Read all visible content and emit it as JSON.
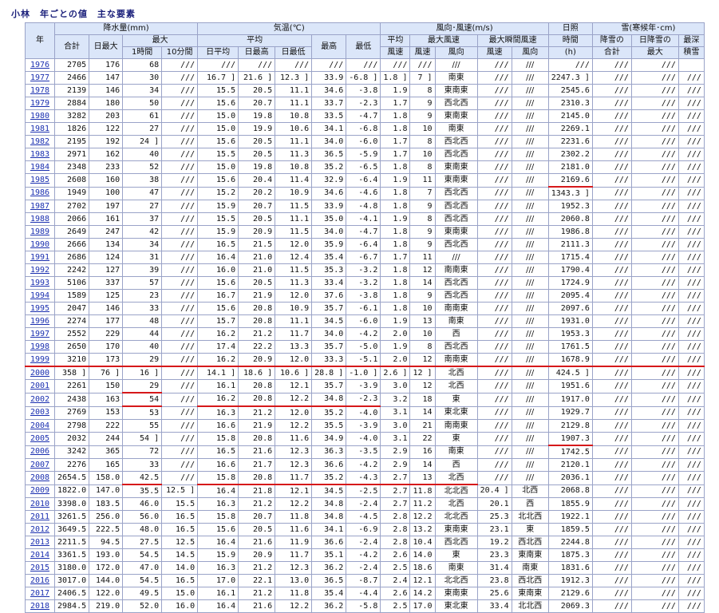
{
  "title": "小林　年ごとの値　主な要素",
  "headers": {
    "year": "年",
    "precip": "降水量(mm)",
    "temp": "気温(℃)",
    "wind": "風向･風速(m/s)",
    "sunshine": "日照",
    "snow": "雪(寒候年･cm)",
    "total": "合計",
    "daily_max": "日最大",
    "max": "最大",
    "h1": "1時間",
    "m10": "10分間",
    "avg": "平均",
    "highest": "最高",
    "lowest": "最低",
    "wind_avg": "平均",
    "wind_avg2": "風速",
    "max_wind": "最大風速",
    "gust": "最大瞬間風速",
    "speed": "風速",
    "direction": "風向",
    "daily_mean": "日平均",
    "daily_high": "日最高",
    "daily_low": "日最低",
    "sun_time": "時間",
    "sun_unit": "(h)",
    "snow_total1": "降雪の",
    "snow_total2": "合計",
    "snow_day1": "日降雪の",
    "snow_day2": "最大",
    "snow_depth1": "最深",
    "snow_depth2": "積雪"
  },
  "rows": [
    [
      "1976",
      "2705",
      "176",
      "68",
      "///",
      "///",
      "///",
      "///",
      "///",
      "///",
      "///",
      "///",
      "///",
      "///",
      "///",
      "///",
      "///",
      "///"
    ],
    [
      "1977",
      "2466",
      "147",
      "30",
      "///",
      "16.7 ]",
      "21.6 ]",
      "12.3 ]",
      "33.9",
      "-6.8 ]",
      "1.8 ]",
      "7 ]",
      "南東",
      "///",
      "///",
      "2247.3 ]",
      "///",
      "///",
      "///"
    ],
    [
      "1978",
      "2139",
      "146",
      "34",
      "///",
      "15.5",
      "20.5",
      "11.1",
      "34.6",
      "-3.8",
      "1.9",
      "8",
      "東南東",
      "///",
      "///",
      "2545.6",
      "///",
      "///",
      "///"
    ],
    [
      "1979",
      "2884",
      "180",
      "50",
      "///",
      "15.6",
      "20.7",
      "11.1",
      "33.7",
      "-2.3",
      "1.7",
      "9",
      "西北西",
      "///",
      "///",
      "2310.3",
      "///",
      "///",
      "///"
    ],
    [
      "1980",
      "3282",
      "203",
      "61",
      "///",
      "15.0",
      "19.8",
      "10.8",
      "33.5",
      "-4.7",
      "1.8",
      "9",
      "東南東",
      "///",
      "///",
      "2145.0",
      "///",
      "///",
      "///"
    ],
    [
      "1981",
      "1826",
      "122",
      "27",
      "///",
      "15.0",
      "19.9",
      "10.6",
      "34.1",
      "-6.8",
      "1.8",
      "10",
      "南東",
      "///",
      "///",
      "2269.1",
      "///",
      "///",
      "///"
    ],
    [
      "1982",
      "2195",
      "192",
      "24 ]",
      "///",
      "15.6",
      "20.5",
      "11.1",
      "34.0",
      "-6.0",
      "1.7",
      "8",
      "西北西",
      "///",
      "///",
      "2231.6",
      "///",
      "///",
      "///"
    ],
    [
      "1983",
      "2971",
      "162",
      "40",
      "///",
      "15.5",
      "20.5",
      "11.3",
      "36.5",
      "-5.9",
      "1.7",
      "10",
      "西北西",
      "///",
      "///",
      "2302.2",
      "///",
      "///",
      "///"
    ],
    [
      "1984",
      "2348",
      "233",
      "52",
      "///",
      "15.0",
      "19.8",
      "10.8",
      "35.2",
      "-6.5",
      "1.8",
      "8",
      "東南東",
      "///",
      "///",
      "2181.0",
      "///",
      "///",
      "///"
    ],
    [
      "1985",
      "2608",
      "160",
      "38",
      "///",
      "15.6",
      "20.4",
      "11.4",
      "32.9",
      "-6.4",
      "1.9",
      "11",
      "東南東",
      "///",
      "///",
      "2169.6",
      "///",
      "///",
      "///"
    ],
    [
      "1986",
      "1949",
      "100",
      "47",
      "///",
      "15.2",
      "20.2",
      "10.9",
      "34.6",
      "-4.6",
      "1.8",
      "7",
      "西北西",
      "///",
      "///",
      "1343.3 ]",
      "///",
      "///",
      "///"
    ],
    [
      "1987",
      "2702",
      "197",
      "27",
      "///",
      "15.9",
      "20.7",
      "11.5",
      "33.9",
      "-4.8",
      "1.8",
      "9",
      "西北西",
      "///",
      "///",
      "1952.3",
      "///",
      "///",
      "///"
    ],
    [
      "1988",
      "2066",
      "161",
      "37",
      "///",
      "15.5",
      "20.5",
      "11.1",
      "35.0",
      "-4.1",
      "1.9",
      "8",
      "西北西",
      "///",
      "///",
      "2060.8",
      "///",
      "///",
      "///"
    ],
    [
      "1989",
      "2649",
      "247",
      "42",
      "///",
      "15.9",
      "20.9",
      "11.5",
      "34.0",
      "-4.7",
      "1.8",
      "9",
      "東南東",
      "///",
      "///",
      "1986.8",
      "///",
      "///",
      "///"
    ],
    [
      "1990",
      "2666",
      "134",
      "34",
      "///",
      "16.5",
      "21.5",
      "12.0",
      "35.9",
      "-6.4",
      "1.8",
      "9",
      "西北西",
      "///",
      "///",
      "2111.3",
      "///",
      "///",
      "///"
    ],
    [
      "1991",
      "2686",
      "124",
      "31",
      "///",
      "16.4",
      "21.0",
      "12.4",
      "35.4",
      "-6.7",
      "1.7",
      "11",
      "///",
      "///",
      "///",
      "1715.4",
      "///",
      "///",
      "///"
    ],
    [
      "1992",
      "2242",
      "127",
      "39",
      "///",
      "16.0",
      "21.0",
      "11.5",
      "35.3",
      "-3.2",
      "1.8",
      "12",
      "南南東",
      "///",
      "///",
      "1790.4",
      "///",
      "///",
      "///"
    ],
    [
      "1993",
      "5106",
      "337",
      "57",
      "///",
      "15.6",
      "20.5",
      "11.3",
      "33.4",
      "-3.2",
      "1.8",
      "14",
      "西北西",
      "///",
      "///",
      "1724.9",
      "///",
      "///",
      "///"
    ],
    [
      "1994",
      "1589",
      "125",
      "23",
      "///",
      "16.7",
      "21.9",
      "12.0",
      "37.6",
      "-3.8",
      "1.8",
      "9",
      "西北西",
      "///",
      "///",
      "2095.4",
      "///",
      "///",
      "///"
    ],
    [
      "1995",
      "2047",
      "146",
      "33",
      "///",
      "15.6",
      "20.8",
      "10.9",
      "35.7",
      "-6.1",
      "1.8",
      "10",
      "南南東",
      "///",
      "///",
      "2097.6",
      "///",
      "///",
      "///"
    ],
    [
      "1996",
      "2274",
      "177",
      "48",
      "///",
      "15.7",
      "20.8",
      "11.1",
      "34.5",
      "-6.0",
      "1.9",
      "13",
      "南東",
      "///",
      "///",
      "1931.0",
      "///",
      "///",
      "///"
    ],
    [
      "1997",
      "2552",
      "229",
      "44",
      "///",
      "16.2",
      "21.2",
      "11.7",
      "34.0",
      "-4.2",
      "2.0",
      "10",
      "西",
      "///",
      "///",
      "1953.3",
      "///",
      "///",
      "///"
    ],
    [
      "1998",
      "2650",
      "170",
      "40",
      "///",
      "17.4",
      "22.2",
      "13.3",
      "35.7",
      "-5.0",
      "1.9",
      "8",
      "西北西",
      "///",
      "///",
      "1761.5",
      "///",
      "///",
      "///"
    ],
    [
      "1999",
      "3210",
      "173",
      "29",
      "///",
      "16.2",
      "20.9",
      "12.0",
      "33.3",
      "-5.1",
      "2.0",
      "12",
      "南南東",
      "///",
      "///",
      "1678.9",
      "///",
      "///",
      "///"
    ],
    [
      "2000",
      "358 ]",
      "76 ]",
      "16 ]",
      "///",
      "14.1 ]",
      "18.6 ]",
      "10.6 ]",
      "28.8 ]",
      "-1.0 ]",
      "2.6 ]",
      "12 ]",
      "北西",
      "///",
      "///",
      "424.5 ]",
      "///",
      "///",
      "///"
    ],
    [
      "2001",
      "2261",
      "150",
      "29",
      "///",
      "16.1",
      "20.8",
      "12.1",
      "35.7",
      "-3.9",
      "3.0",
      "12",
      "北西",
      "///",
      "///",
      "1951.6",
      "///",
      "///",
      "///"
    ],
    [
      "2002",
      "2438",
      "163",
      "54",
      "///",
      "16.2",
      "20.8",
      "12.2",
      "34.8",
      "-2.3",
      "3.2",
      "18",
      "東",
      "///",
      "///",
      "1917.0",
      "///",
      "///",
      "///"
    ],
    [
      "2003",
      "2769",
      "153",
      "53",
      "///",
      "16.3",
      "21.2",
      "12.0",
      "35.2",
      "-4.0",
      "3.1",
      "14",
      "東北東",
      "///",
      "///",
      "1929.7",
      "///",
      "///",
      "///"
    ],
    [
      "2004",
      "2798",
      "222",
      "55",
      "///",
      "16.6",
      "21.9",
      "12.2",
      "35.5",
      "-3.9",
      "3.0",
      "21",
      "南南東",
      "///",
      "///",
      "2129.8",
      "///",
      "///",
      "///"
    ],
    [
      "2005",
      "2032",
      "244",
      "54 ]",
      "///",
      "15.8",
      "20.8",
      "11.6",
      "34.9",
      "-4.0",
      "3.1",
      "22",
      "東",
      "///",
      "///",
      "1907.3",
      "///",
      "///",
      "///"
    ],
    [
      "2006",
      "3242",
      "365",
      "72",
      "///",
      "16.5",
      "21.6",
      "12.3",
      "36.3",
      "-3.5",
      "2.9",
      "16",
      "南東",
      "///",
      "///",
      "1742.5",
      "///",
      "///",
      "///"
    ],
    [
      "2007",
      "2276",
      "165",
      "33",
      "///",
      "16.6",
      "21.7",
      "12.3",
      "36.6",
      "-4.2",
      "2.9",
      "14",
      "西",
      "///",
      "///",
      "2120.1",
      "///",
      "///",
      "///"
    ],
    [
      "2008",
      "2654.5",
      "158.0",
      "42.5",
      "///",
      "15.8",
      "20.8",
      "11.7",
      "35.2",
      "-4.3",
      "2.7",
      "13",
      "北西",
      "///",
      "///",
      "2036.1",
      "///",
      "///",
      "///"
    ],
    [
      "2009",
      "1822.0",
      "147.0",
      "35.5",
      "12.5 ]",
      "16.4",
      "21.8",
      "12.1",
      "34.5",
      "-2.5",
      "2.7",
      "11.8",
      "北北西",
      "20.4 ]",
      "北西",
      "2068.8",
      "///",
      "///",
      "///"
    ],
    [
      "2010",
      "3398.0",
      "183.5",
      "46.0",
      "15.5",
      "16.3",
      "21.2",
      "12.2",
      "34.8",
      "-2.4",
      "2.7",
      "11.2",
      "北西",
      "20.1",
      "西",
      "1855.9",
      "///",
      "///",
      "///"
    ],
    [
      "2011",
      "3261.5",
      "256.0",
      "56.0",
      "16.5",
      "15.8",
      "20.7",
      "11.8",
      "34.8",
      "-4.5",
      "2.8",
      "12.2",
      "北北西",
      "25.3",
      "北北西",
      "1922.1",
      "///",
      "///",
      "///"
    ],
    [
      "2012",
      "3649.5",
      "222.5",
      "48.0",
      "16.5",
      "15.6",
      "20.5",
      "11.6",
      "34.1",
      "-6.9",
      "2.8",
      "13.2",
      "東南東",
      "23.1",
      "東",
      "1859.5",
      "///",
      "///",
      "///"
    ],
    [
      "2013",
      "2211.5",
      "94.5",
      "27.5",
      "12.5",
      "16.4",
      "21.6",
      "11.9",
      "36.6",
      "-2.4",
      "2.8",
      "10.4",
      "西北西",
      "19.2",
      "西北西",
      "2244.8",
      "///",
      "///",
      "///"
    ],
    [
      "2014",
      "3361.5",
      "193.0",
      "54.5",
      "14.5",
      "15.9",
      "20.9",
      "11.7",
      "35.1",
      "-4.2",
      "2.6",
      "14.0",
      "東",
      "23.3",
      "東南東",
      "1875.3",
      "///",
      "///",
      "///"
    ],
    [
      "2015",
      "3180.0",
      "172.0",
      "47.0",
      "14.0",
      "16.3",
      "21.2",
      "12.3",
      "36.2",
      "-2.4",
      "2.5",
      "18.6",
      "南東",
      "31.4",
      "南東",
      "1831.6",
      "///",
      "///",
      "///"
    ],
    [
      "2016",
      "3017.0",
      "144.0",
      "54.5",
      "16.5",
      "17.0",
      "22.1",
      "13.0",
      "36.5",
      "-8.7",
      "2.4",
      "12.1",
      "北北西",
      "23.8",
      "西北西",
      "1912.3",
      "///",
      "///",
      "///"
    ],
    [
      "2017",
      "2406.5",
      "122.0",
      "49.5",
      "15.0",
      "16.1",
      "21.2",
      "11.8",
      "35.4",
      "-4.4",
      "2.6",
      "14.2",
      "東南東",
      "25.6",
      "東南東",
      "2129.6",
      "///",
      "///",
      "///"
    ],
    [
      "2018",
      "2984.5",
      "219.0",
      "52.0",
      "16.0",
      "16.4",
      "21.6",
      "12.2",
      "36.2",
      "-5.8",
      "2.5",
      "17.0",
      "東北東",
      "33.4",
      "北北西",
      "2069.3",
      "///",
      "///",
      "///"
    ]
  ]
}
